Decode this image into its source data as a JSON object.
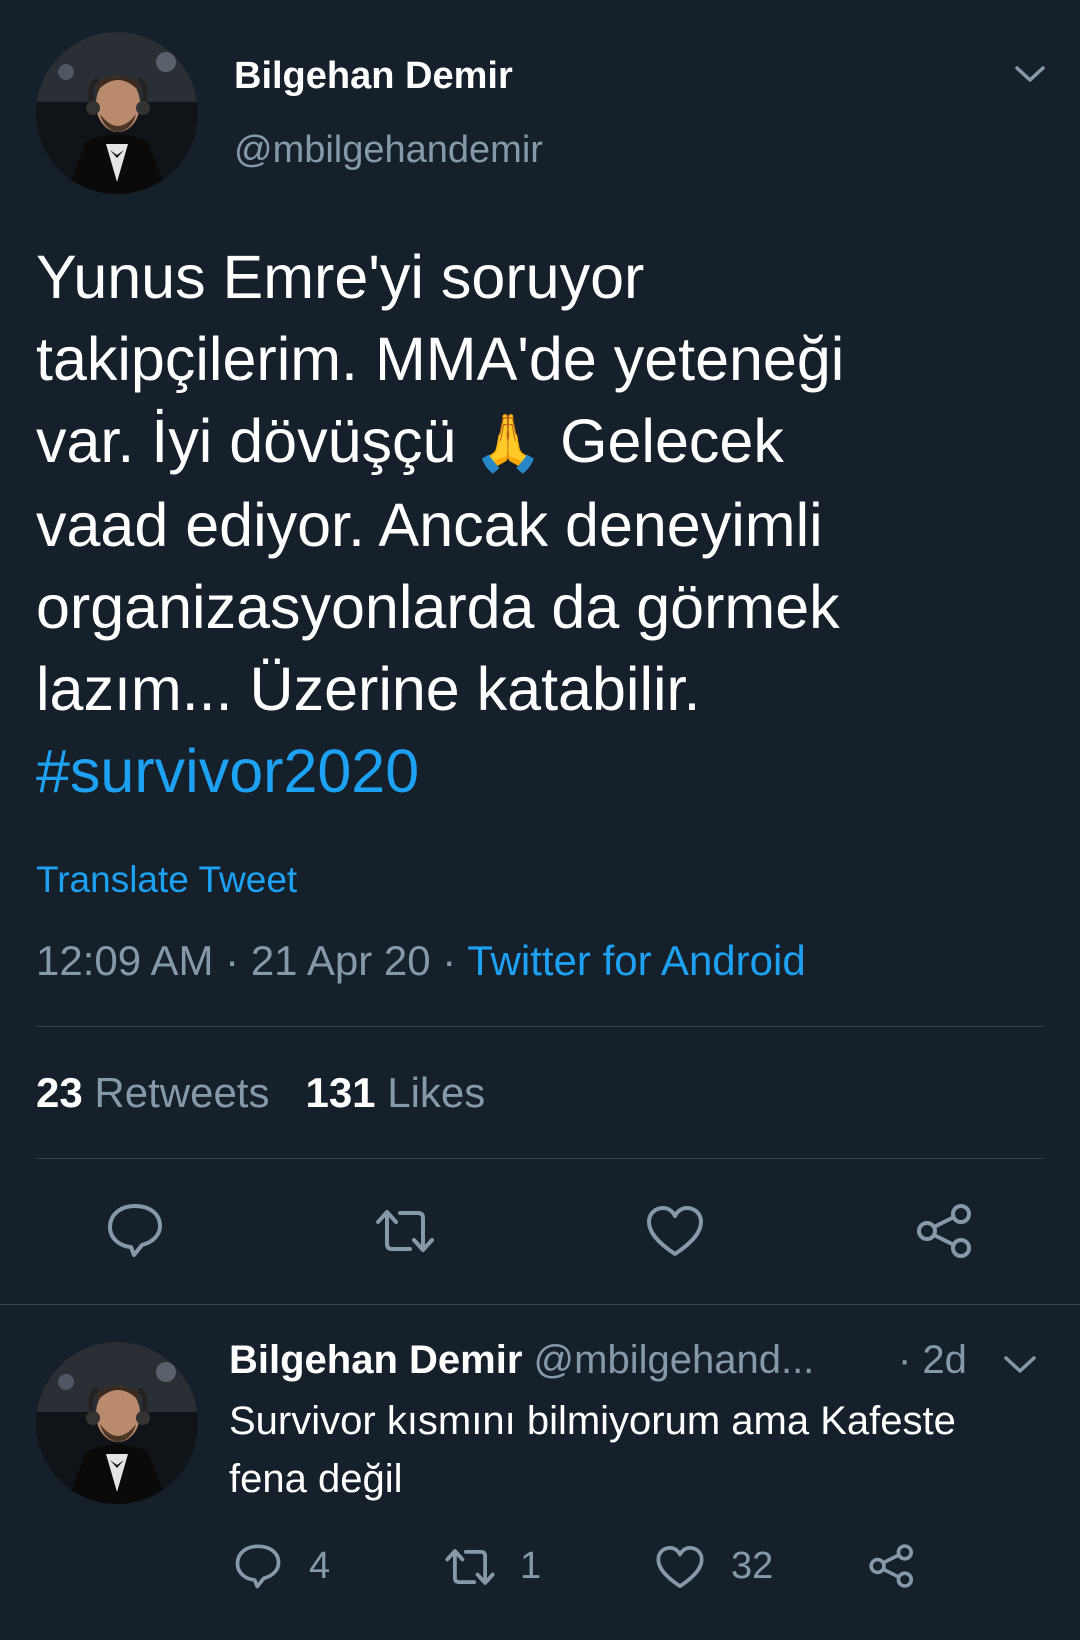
{
  "main_tweet": {
    "author_name": "Bilgehan Demir",
    "author_handle": "@mbilgehandemir",
    "text_lines": [
      "Yunus Emre'yi soruyor",
      "takipçilerim. MMA'de yeteneği",
      "var. İyi dövüşçü",
      "Gelecek",
      "vaad ediyor. Ancak deneyimli",
      "organizasyonlarda da görmek",
      "lazım... Üzerine katabilir."
    ],
    "emoji": "🙏",
    "hashtag": "#survivor2020",
    "translate_label": "Translate Tweet",
    "time": "12:09 AM",
    "separator": "·",
    "date": "21 Apr 20",
    "source": "Twitter for Android",
    "retweets_count": "23",
    "retweets_label": "Retweets",
    "likes_count": "131",
    "likes_label": "Likes"
  },
  "reply_tweet": {
    "author_name": "Bilgehan Demir",
    "author_handle": "@mbilgehand...",
    "age": "· 2d",
    "text_lines": [
      "Survivor kısmını bilmiyorum ama Kafeste",
      "fena değil"
    ],
    "reply_count": "4",
    "retweet_count": "1",
    "like_count": "32"
  },
  "colors": {
    "background": "#15202b",
    "accent": "#1da1f2",
    "muted": "#8899a6",
    "divider": "#38444d"
  },
  "icons": [
    "chevron-down-icon",
    "reply-icon",
    "retweet-icon",
    "like-icon",
    "share-icon"
  ]
}
